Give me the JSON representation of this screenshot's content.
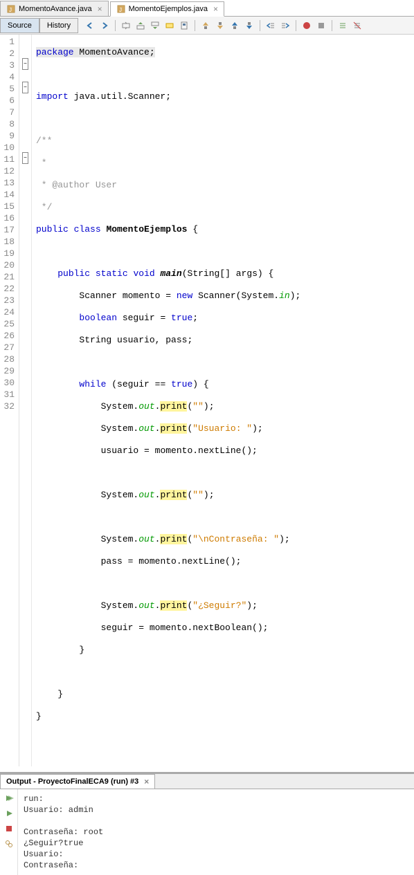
{
  "tabs": [
    {
      "label": "MomentoAvance.java",
      "active": false
    },
    {
      "label": "MomentoEjemplos.java",
      "active": true
    }
  ],
  "subtabs": {
    "source": "Source",
    "history": "History"
  },
  "code": {
    "lines": [
      {
        "n": 1,
        "fold": null
      },
      {
        "n": 2,
        "fold": null
      },
      {
        "n": 3,
        "fold": "-"
      },
      {
        "n": 4,
        "fold": null
      },
      {
        "n": 5,
        "fold": "-"
      },
      {
        "n": 6,
        "fold": null
      },
      {
        "n": 7,
        "fold": null
      },
      {
        "n": 8,
        "fold": null
      },
      {
        "n": 9,
        "fold": null
      },
      {
        "n": 10,
        "fold": null
      },
      {
        "n": 11,
        "fold": "-"
      },
      {
        "n": 12,
        "fold": null
      },
      {
        "n": 13,
        "fold": null
      },
      {
        "n": 14,
        "fold": null
      },
      {
        "n": 15,
        "fold": null
      },
      {
        "n": 16,
        "fold": null
      },
      {
        "n": 17,
        "fold": null
      },
      {
        "n": 18,
        "fold": null
      },
      {
        "n": 19,
        "fold": null
      },
      {
        "n": 20,
        "fold": null
      },
      {
        "n": 21,
        "fold": null
      },
      {
        "n": 22,
        "fold": null
      },
      {
        "n": 23,
        "fold": null
      },
      {
        "n": 24,
        "fold": null
      },
      {
        "n": 25,
        "fold": null
      },
      {
        "n": 26,
        "fold": null
      },
      {
        "n": 27,
        "fold": null
      },
      {
        "n": 28,
        "fold": null
      },
      {
        "n": 29,
        "fold": null
      },
      {
        "n": 30,
        "fold": null
      },
      {
        "n": 31,
        "fold": null
      },
      {
        "n": 32,
        "fold": null
      }
    ],
    "tokens": {
      "l1": {
        "a": "package",
        "b": " MomentoAvance;"
      },
      "l3": {
        "a": "import",
        "b": " java.util.Scanner;"
      },
      "l5": "/**",
      "l6": " *",
      "l7": " * @author User",
      "l8": " */",
      "l9": {
        "a": "public",
        "b": "class",
        "c": "MomentoEjemplos",
        "d": " {"
      },
      "l11": {
        "a": "public",
        "b": "static",
        "c": "void",
        "d": "main",
        "e": "(String[] args) {"
      },
      "l12": {
        "a": "Scanner momento = ",
        "b": "new",
        "c": " Scanner(System.",
        "d": "in",
        "e": ");"
      },
      "l13": {
        "a": "boolean",
        "b": " seguir = ",
        "c": "true",
        "d": ";"
      },
      "l14": {
        "a": "String usuario, pass;"
      },
      "l16": {
        "a": "while",
        "b": " (seguir == ",
        "c": "true",
        "d": ") {"
      },
      "l17": {
        "a": "System.",
        "b": "out",
        "c": ".",
        "d": "print",
        "e": "(",
        "f": "\"\"",
        "g": ");"
      },
      "l18": {
        "a": "System.",
        "b": "out",
        "c": ".",
        "d": "print",
        "e": "(",
        "f": "\"Usuario: \"",
        "g": ");"
      },
      "l19": {
        "a": "usuario = momento.nextLine();"
      },
      "l21": {
        "a": "System.",
        "b": "out",
        "c": ".",
        "d": "print",
        "e": "(",
        "f": "\"\"",
        "g": ");"
      },
      "l23": {
        "a": "System.",
        "b": "out",
        "c": ".",
        "d": "print",
        "e": "(",
        "f": "\"\\nContraseña: \"",
        "g": ");"
      },
      "l24": {
        "a": "pass = momento.nextLine();"
      },
      "l26": {
        "a": "System.",
        "b": "out",
        "c": ".",
        "d": "print",
        "e": "(",
        "f": "\"¿Seguir?\"",
        "g": ");"
      },
      "l27": {
        "a": "seguir = momento.nextBoolean();"
      },
      "l28": "}",
      "l30": "}",
      "l31": "}"
    }
  },
  "output": {
    "title": "Output - ProyectoFinalECA9 (run) #3",
    "lines": [
      "run:",
      "Usuario: admin",
      "",
      "Contraseña: root",
      "¿Seguir?true",
      "Usuario: ",
      "Contraseña: "
    ]
  }
}
